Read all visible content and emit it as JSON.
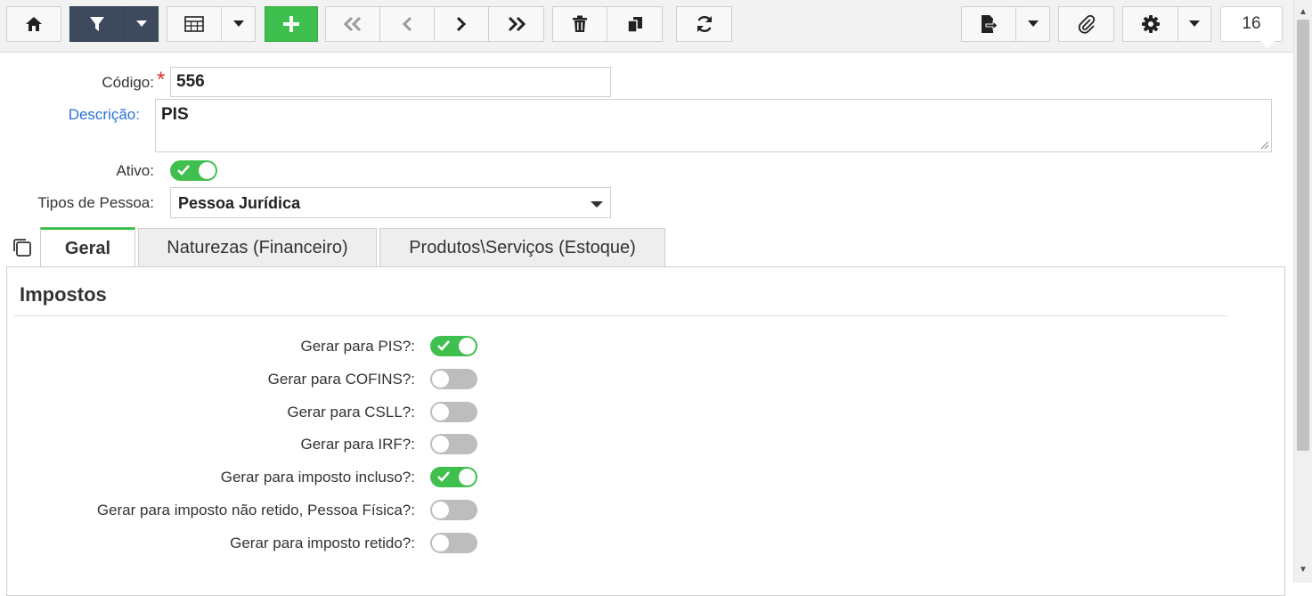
{
  "toolbar": {
    "buttons": [
      {
        "name": "home-button",
        "icon": "home-icon"
      },
      {
        "name": "filter-button",
        "icon": "filter-icon"
      },
      {
        "name": "filter-dropdown-button",
        "icon": "caret-down-icon"
      },
      {
        "name": "grid-view-button",
        "icon": "table-icon"
      },
      {
        "name": "grid-view-dropdown-button",
        "icon": "caret-down-icon"
      },
      {
        "name": "add-button",
        "icon": "plus-icon"
      },
      {
        "name": "first-record-button",
        "icon": "double-chevron-left-icon"
      },
      {
        "name": "previous-record-button",
        "icon": "chevron-left-icon"
      },
      {
        "name": "next-record-button",
        "icon": "chevron-right-icon"
      },
      {
        "name": "last-record-button",
        "icon": "double-chevron-right-icon"
      },
      {
        "name": "delete-button",
        "icon": "trash-icon"
      },
      {
        "name": "duplicate-button",
        "icon": "copy-icon"
      },
      {
        "name": "refresh-button",
        "icon": "refresh-icon"
      },
      {
        "name": "export-button",
        "icon": "export-icon"
      },
      {
        "name": "export-dropdown-button",
        "icon": "caret-down-icon"
      },
      {
        "name": "attachment-button",
        "icon": "paperclip-icon"
      },
      {
        "name": "settings-button",
        "icon": "gear-icon"
      },
      {
        "name": "settings-dropdown-button",
        "icon": "caret-down-icon"
      }
    ],
    "record_count": "16"
  },
  "form": {
    "codigo_label": "Código:",
    "required_mark": "*",
    "codigo_value": "556",
    "descricao_label": "Descrição:",
    "descricao_value": "PIS",
    "ativo_label": "Ativo:",
    "ativo_on": true,
    "tipos_label": "Tipos de Pessoa:",
    "tipos_value": "Pessoa Jurídica"
  },
  "tabs": [
    {
      "label": "Geral",
      "active": true
    },
    {
      "label": "Naturezas (Financeiro)",
      "active": false
    },
    {
      "label": "Produtos\\Serviços (Estoque)",
      "active": false
    }
  ],
  "impostos": {
    "title": "Impostos",
    "items": [
      {
        "label": "Gerar para PIS?:",
        "on": true
      },
      {
        "label": "Gerar para COFINS?:",
        "on": false
      },
      {
        "label": "Gerar para CSLL?:",
        "on": false
      },
      {
        "label": "Gerar para IRF?:",
        "on": false
      },
      {
        "label": "Gerar para imposto incluso?:",
        "on": true
      },
      {
        "label": "Gerar para imposto não retido, Pessoa Física?:",
        "on": false
      },
      {
        "label": "Gerar para imposto retido?:",
        "on": false
      }
    ]
  },
  "colors": {
    "accent_green": "#3fbf4d",
    "dark_button": "#3d4a5d",
    "link_blue": "#2b73d6",
    "required_red": "#d9342b",
    "toggle_off": "#bdbdbd"
  }
}
